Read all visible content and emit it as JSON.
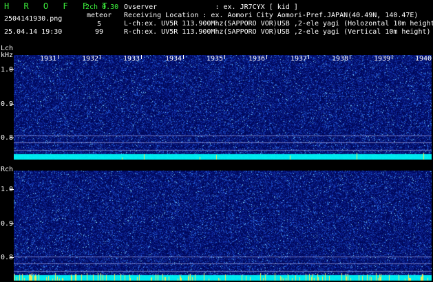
{
  "header": {
    "app_title": "H R O F F T",
    "channel": "2ch 0.30",
    "meteor_label": "meteor",
    "filename": "2504141930.png",
    "datetime": "25.04.14 19:30",
    "lch_count": "5",
    "rch_count": "99",
    "observer": "Ovserver              : ex. JR7CYX [ kid ]",
    "location": "Receiving Location : ex. Aomori City Aomori-Pref.JAPAN(40.49N, 140.47E)",
    "lch_info": "L-ch:ex. UV5R 113.900Mhz(SAPPORO VOR)USB ,2-ele yagi (Holozontal 10m height",
    "rch_info": "R-ch:ex. UV5R 113.900Mhz(SAPPORO VOR)USB ,2-ele yagi (Vertical 10m height)"
  },
  "axes": {
    "lch_label": "Lch",
    "unit_label": "kHz",
    "rch_label": "Rch",
    "y_ticks": [
      "1.0",
      "0.9",
      "0.8"
    ],
    "x_ticks": [
      "1931",
      "1932",
      "1933",
      "1934",
      "1935",
      "1936",
      "1937",
      "1938",
      "1939",
      "1940"
    ]
  },
  "colors": {
    "title_green": "#3cf03c",
    "noise_dark": "#000a5a",
    "noise_mid": "#1e3cb4",
    "noise_bright": "#64c8ff",
    "carrier": "#00e8f0",
    "meteor": "#e8e85a"
  }
}
